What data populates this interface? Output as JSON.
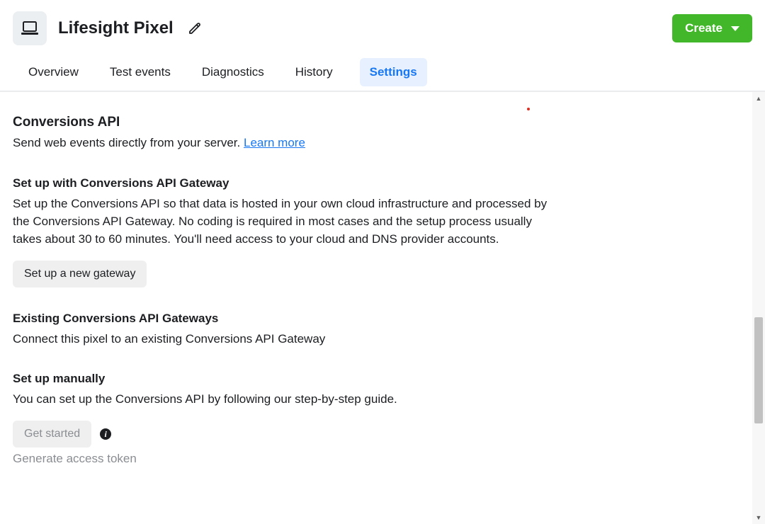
{
  "header": {
    "title": "Lifesight Pixel",
    "create_label": "Create"
  },
  "tabs": [
    {
      "label": "Overview",
      "active": false
    },
    {
      "label": "Test events",
      "active": false
    },
    {
      "label": "Diagnostics",
      "active": false
    },
    {
      "label": "History",
      "active": false
    },
    {
      "label": "Settings",
      "active": true
    }
  ],
  "sections": {
    "conversions_api": {
      "title": "Conversions API",
      "desc": "Send web events directly from your server. ",
      "learn_more": "Learn more"
    },
    "gateway": {
      "title": "Set up with Conversions API Gateway",
      "desc": "Set up the Conversions API so that data is hosted in your own cloud infrastructure and processed by the Conversions API Gateway. No coding is required in most cases and the setup process usually takes about 30 to 60 minutes. You'll need access to your cloud and DNS provider accounts.",
      "button": "Set up a new gateway"
    },
    "existing": {
      "title": "Existing Conversions API Gateways",
      "desc": "Connect this pixel to an existing Conversions API Gateway"
    },
    "manual": {
      "title": "Set up manually",
      "desc": "You can set up the Conversions API by following our step-by-step guide.",
      "button": "Get started",
      "token_link": "Generate access token"
    }
  }
}
